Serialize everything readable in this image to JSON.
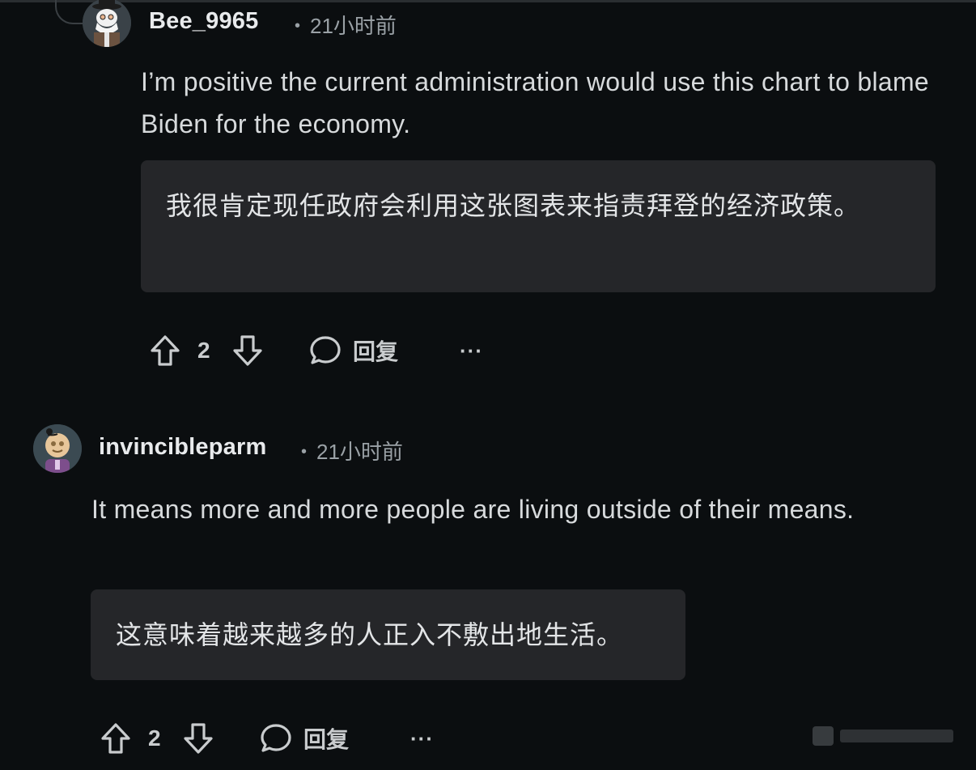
{
  "comments": [
    {
      "username": "Bee_9965",
      "time": "21小时前",
      "text": "I’m positive the current administration would use this chart to blame Biden for the economy.",
      "translation": "我很肯定现任政府会利用这张图表来指责拜登的经济政策。",
      "votes": "2",
      "reply_label": "回复",
      "more_label": "···"
    },
    {
      "username": "invincibleparm",
      "time": "21小时前",
      "text": "It means more and more people are living outside of their means.",
      "translation": "这意味着越来越多的人正入不敷出地生活。",
      "votes": "2",
      "reply_label": "回复",
      "more_label": "···"
    }
  ],
  "meta_separator": "•",
  "icons": {
    "upvote": "arrow-up-outline-icon",
    "downvote": "arrow-down-outline-icon",
    "reply": "speech-bubble-icon"
  },
  "colors": {
    "background": "#0b0e10",
    "translation_box": "#252629",
    "text": "#d7dadc",
    "meta": "#9aa1a6"
  }
}
